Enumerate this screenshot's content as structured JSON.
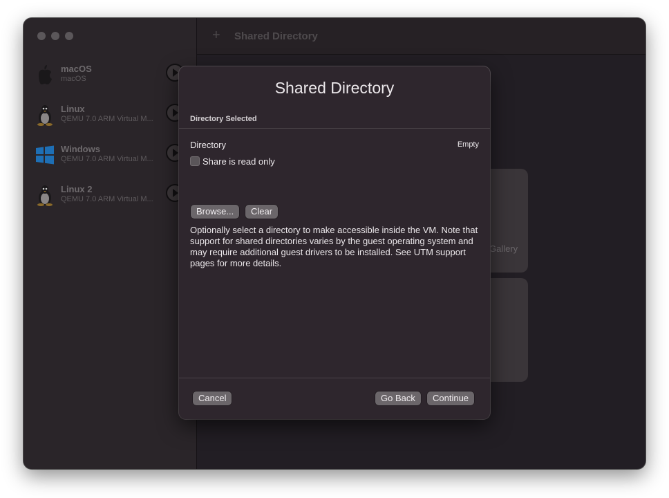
{
  "sidebar": {
    "items": [
      {
        "title": "macOS",
        "subtitle": "macOS",
        "icon": "apple-icon"
      },
      {
        "title": "Linux",
        "subtitle": "QEMU 7.0 ARM Virtual M...",
        "icon": "tux-icon"
      },
      {
        "title": "Windows",
        "subtitle": "QEMU 7.0 ARM Virtual M...",
        "icon": "windows-icon"
      },
      {
        "title": "Linux 2",
        "subtitle": "QEMU 7.0 ARM Virtual M...",
        "icon": "tux-icon"
      }
    ]
  },
  "toolbar": {
    "add_icon": "+",
    "title": "Shared Directory"
  },
  "background": {
    "card_text": "Gallery"
  },
  "dialog": {
    "title": "Shared Directory",
    "section_header": "Directory Selected",
    "directory_label": "Directory",
    "directory_value": "Empty",
    "readonly_label": "Share is read only",
    "readonly_checked": false,
    "browse_label": "Browse...",
    "clear_label": "Clear",
    "description": "Optionally select a directory to make accessible inside the VM. Note that support for shared directories varies by the guest operating system and may require additional guest drivers to be installed. See UTM support pages for more details.",
    "cancel_label": "Cancel",
    "go_back_label": "Go Back",
    "continue_label": "Continue"
  },
  "colors": {
    "window_bg": "#221e24",
    "dialog_bg": "#2e262d",
    "button_bg": "#6b666a",
    "windows_blue": "#1e6fb5"
  }
}
